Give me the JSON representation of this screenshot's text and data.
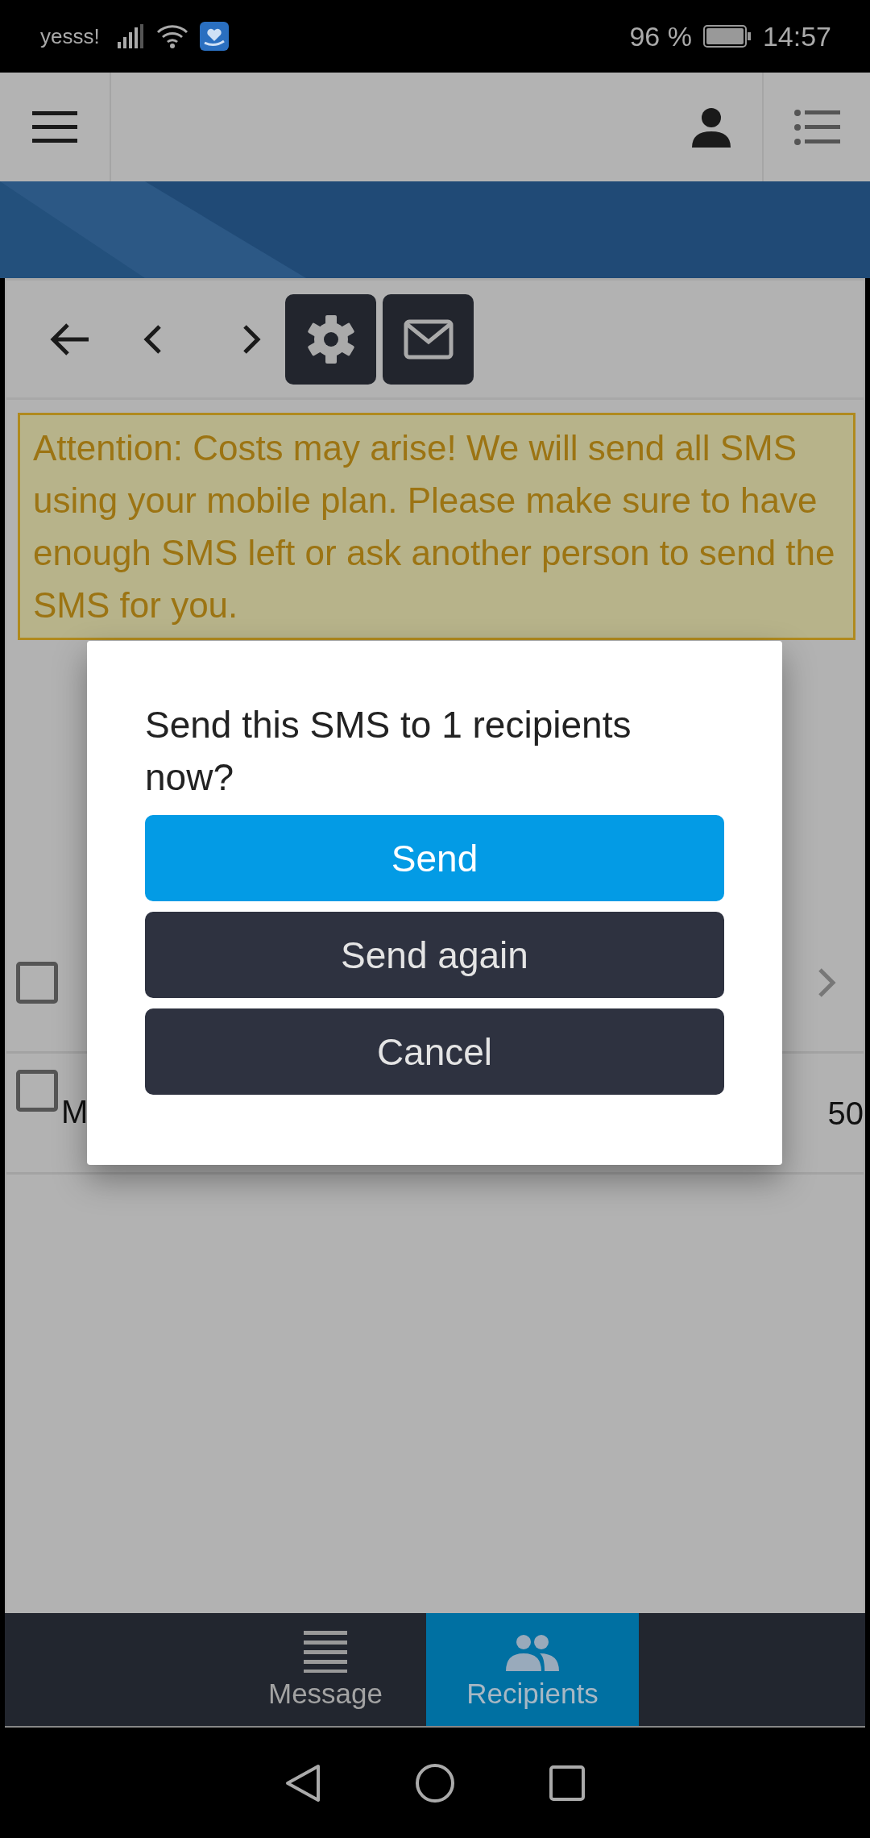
{
  "status_bar": {
    "carrier": "yesss!",
    "battery": "96 %",
    "time": "14:57"
  },
  "warning": {
    "text": "Attention: Costs may arise! We will send all SMS using your mobile plan. Please make sure to have enough SMS left or ask another person to send the SMS for you."
  },
  "recipients": [
    {
      "checked": false
    },
    {
      "checked": false,
      "name": "M",
      "value": "50"
    }
  ],
  "dialog": {
    "message": "Send this SMS to 1 recipients now?",
    "buttons": [
      {
        "label": "Send",
        "kind": "primary"
      },
      {
        "label": "Send again",
        "kind": "secondary"
      },
      {
        "label": "Cancel",
        "kind": "secondary"
      }
    ]
  },
  "bottom_nav": [
    {
      "label": "Message",
      "selected": false
    },
    {
      "label": "Recipients",
      "selected": true
    }
  ]
}
